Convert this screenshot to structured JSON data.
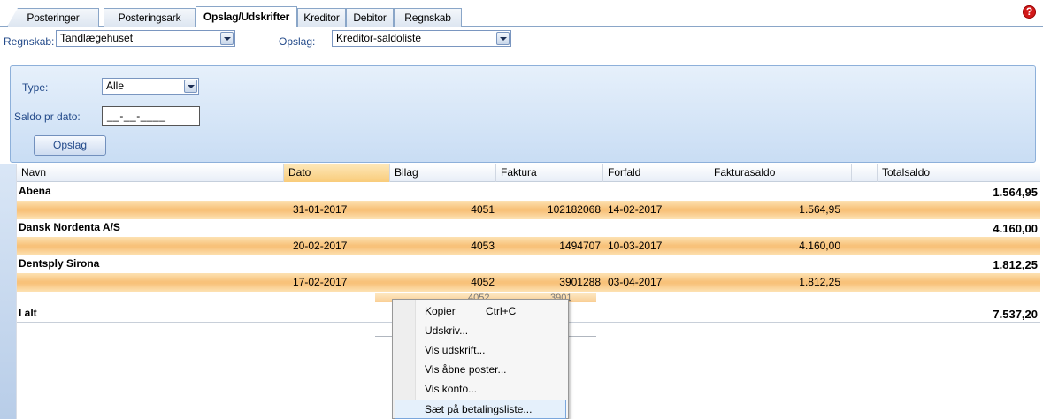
{
  "tabs": [
    {
      "label": "Posteringer"
    },
    {
      "label": "Posteringsark"
    },
    {
      "label": "Opslag/Udskrifter"
    },
    {
      "label": "Kreditor"
    },
    {
      "label": "Debitor"
    },
    {
      "label": "Regnskab"
    }
  ],
  "active_tab": "Opslag/Udskrifter",
  "help_icon": "?",
  "topbar": {
    "regnskab_label": "Regnskab:",
    "regnskab_value": "Tandlægehuset",
    "opslag_label": "Opslag:",
    "opslag_value": "Kreditor-saldoliste"
  },
  "filter": {
    "type_label": "Type:",
    "type_value": "Alle",
    "saldo_label": "Saldo pr dato:",
    "saldo_value": "__-__-____",
    "opslag_button": "Opslag"
  },
  "grid": {
    "columns": [
      "Navn",
      "Dato",
      "Bilag",
      "Faktura",
      "Forfald",
      "Fakturasaldo",
      "",
      "Totalsaldo"
    ],
    "sorted_column": "Dato",
    "groups": [
      {
        "name": "Abena",
        "total": "1.564,95",
        "rows": [
          {
            "dato": "31-01-2017",
            "bilag": "4051",
            "faktura": "102182068",
            "forfald": "14-02-2017",
            "fakturasaldo": "1.564,95"
          }
        ]
      },
      {
        "name": "Dansk Nordenta A/S",
        "total": "4.160,00",
        "rows": [
          {
            "dato": "20-02-2017",
            "bilag": "4053",
            "faktura": "1494707",
            "forfald": "10-03-2017",
            "fakturasaldo": "4.160,00"
          }
        ]
      },
      {
        "name": "Dentsply Sirona",
        "total": "1.812,25",
        "rows": [
          {
            "dato": "17-02-2017",
            "bilag": "4052",
            "faktura": "3901288",
            "forfald": "03-04-2017",
            "fakturasaldo": "1.812,25"
          }
        ]
      }
    ],
    "drag_ghost": {
      "bilag": "4052",
      "faktura": "3901"
    },
    "grand_total_label": "I alt",
    "grand_total": "7.537,20"
  },
  "context_menu": {
    "items": [
      {
        "label": "Kopier",
        "shortcut": "Ctrl+C"
      },
      {
        "label": "Udskriv..."
      },
      {
        "label": "Vis udskrift..."
      },
      {
        "label": "Vis åbne poster..."
      },
      {
        "label": "Vis konto..."
      },
      {
        "label": "Sæt på betalingsliste..."
      }
    ],
    "highlighted": "Sæt på betalingsliste..."
  },
  "colors": {
    "accent": "#8db0da",
    "row_highlight": "#f8c27a",
    "help_icon": "#d21818"
  }
}
